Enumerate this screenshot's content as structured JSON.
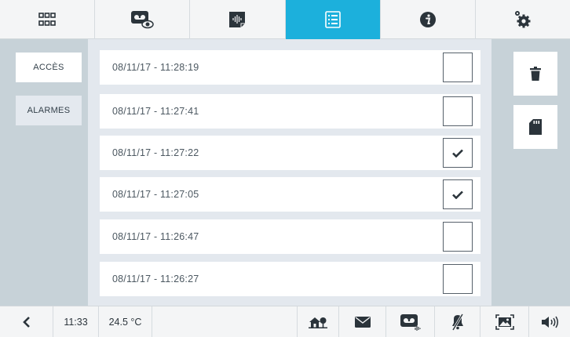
{
  "top_tabs": [
    {
      "icon": "grid-icon"
    },
    {
      "icon": "voicemail-view-icon"
    },
    {
      "icon": "audio-message-icon"
    },
    {
      "icon": "list-icon",
      "active": true
    },
    {
      "icon": "info-icon"
    },
    {
      "icon": "settings-gears-icon"
    }
  ],
  "sidebar": {
    "items": [
      {
        "label": "ACCÈS",
        "active": false
      },
      {
        "label": "ALARMES",
        "active": true
      }
    ]
  },
  "records": [
    {
      "timestamp": "08/11/17 - 11:28:19",
      "checked": false
    },
    {
      "timestamp": "08/11/17 - 11:27:41",
      "checked": false
    },
    {
      "timestamp": "08/11/17 - 11:27:22",
      "checked": true
    },
    {
      "timestamp": "08/11/17 - 11:27:05",
      "checked": true
    },
    {
      "timestamp": "08/11/17 - 11:26:47",
      "checked": false
    },
    {
      "timestamp": "08/11/17 - 11:26:27",
      "checked": false
    }
  ],
  "actions": [
    {
      "icon": "trash-icon"
    },
    {
      "icon": "sd-card-icon"
    }
  ],
  "status_bar": {
    "time": "11:33",
    "temperature": "24.5 °C",
    "icons": [
      "back-icon",
      "home-trees-icon",
      "mail-icon",
      "voicemail-audio-icon",
      "mute-bell-icon",
      "gallery-icon",
      "volume-icon"
    ]
  },
  "colors": {
    "accent": "#1cb0dc",
    "side_panel": "#c7d2d8",
    "main_panel": "#e3e8ee",
    "icon_dark": "#2b343b"
  }
}
